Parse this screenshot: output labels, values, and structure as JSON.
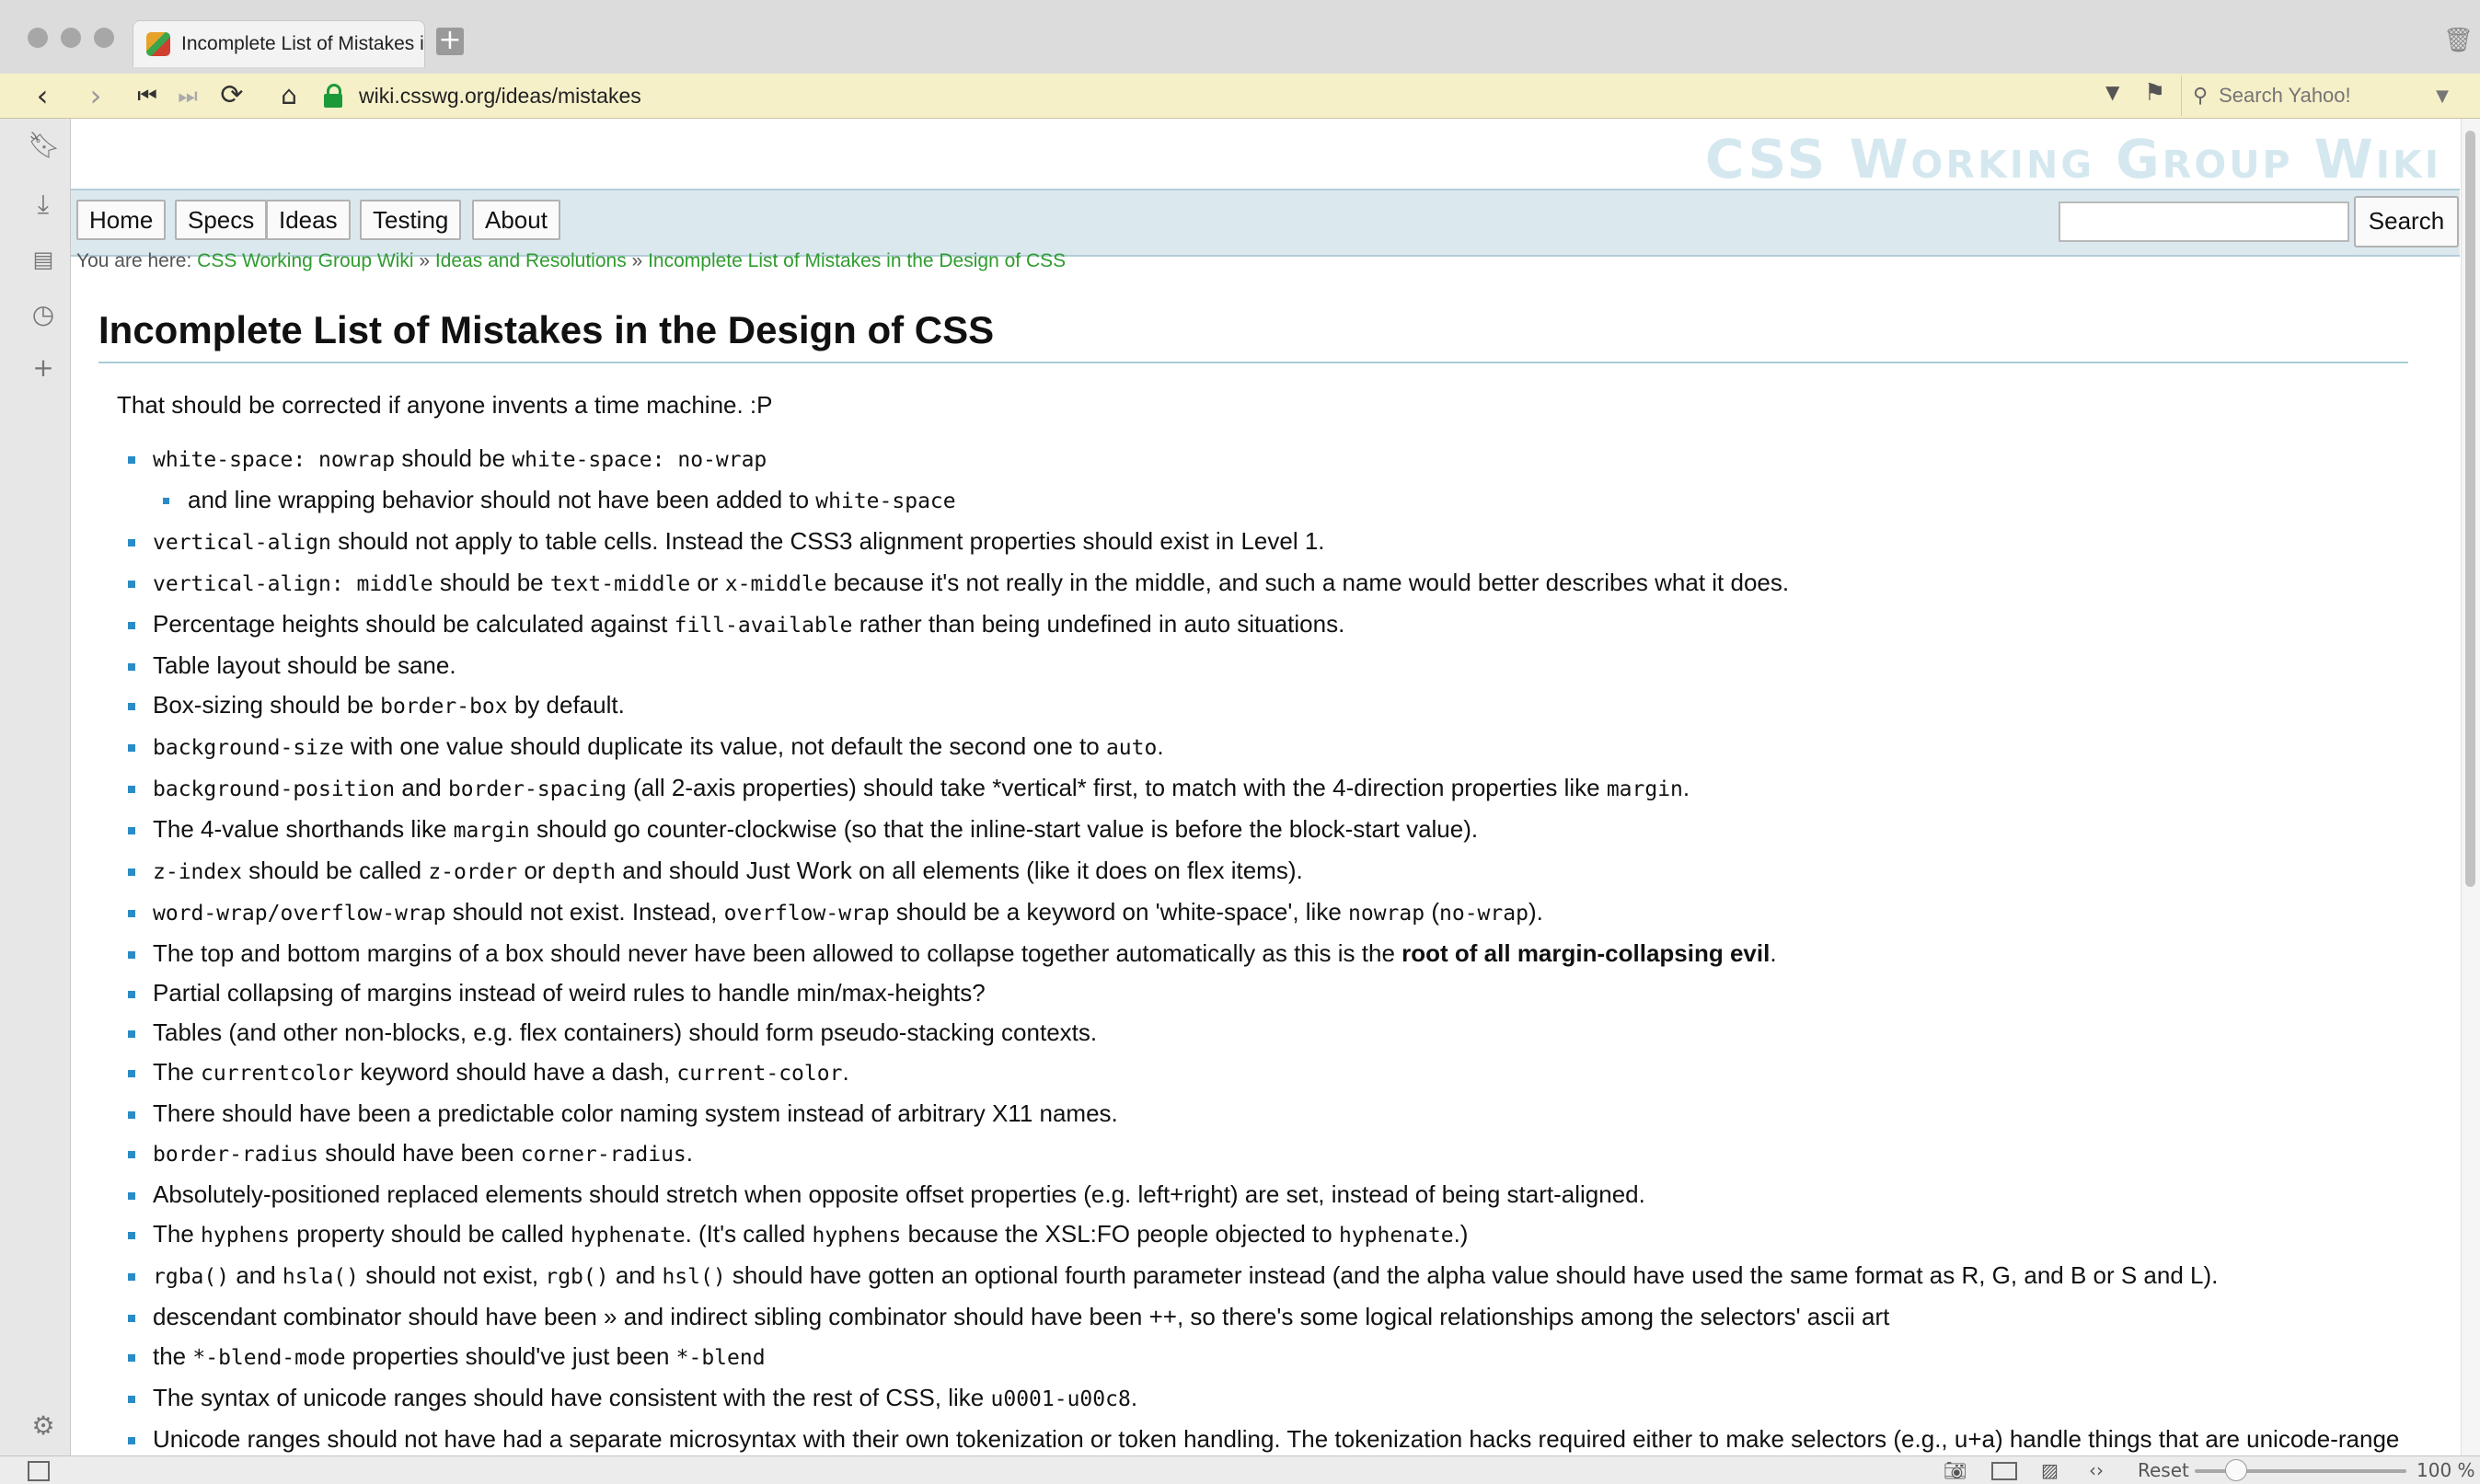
{
  "browser": {
    "tab_title": "Incomplete List of Mistakes in",
    "new_tab": "+",
    "url": "wiki.csswg.org/ideas/mistakes",
    "search_placeholder": "Search Yahoo!",
    "status": {
      "reset_label": "Reset",
      "zoom_label": "100 %",
      "zoom_value": 1.0
    },
    "icons": {
      "back": "arrow-left-icon",
      "forward": "arrow-right-icon",
      "first": "rewind-icon",
      "last": "fast-forward-icon",
      "reload": "reload-icon",
      "home": "home-icon",
      "lock": "lock-icon",
      "bookmarks": "bookmark-icon",
      "downloads": "download-icon",
      "notes": "notes-icon",
      "history": "clock-icon",
      "add_panel": "plus-icon",
      "settings": "gear-icon"
    }
  },
  "site": {
    "wiki_title": "CSS Working Group Wiki",
    "nav": [
      "Home",
      "Specs",
      "Ideas",
      "Testing",
      "About"
    ],
    "search_button": "Search",
    "breadcrumb": {
      "prefix": "You are here:",
      "items": [
        "CSS Working Group Wiki",
        "Ideas and Resolutions",
        "Incomplete List of Mistakes in the Design of CSS"
      ],
      "separator": "»"
    }
  },
  "article": {
    "title": "Incomplete List of Mistakes in the Design of CSS",
    "intro": "That should be corrected if anyone invents a time machine. :P",
    "items": [
      {
        "sub": false,
        "parts": [
          {
            "code": "white-space: nowrap"
          },
          {
            "text": " should be "
          },
          {
            "code": "white-space: no-wrap"
          }
        ]
      },
      {
        "sub": true,
        "parts": [
          {
            "text": "and line wrapping behavior should not have been added to "
          },
          {
            "code": "white-space"
          }
        ]
      },
      {
        "sub": false,
        "parts": [
          {
            "code": "vertical-align"
          },
          {
            "text": " should not apply to table cells. Instead the CSS3 alignment properties should exist in Level 1."
          }
        ]
      },
      {
        "sub": false,
        "parts": [
          {
            "code": "vertical-align: middle"
          },
          {
            "text": " should be "
          },
          {
            "code": "text-middle"
          },
          {
            "text": " or "
          },
          {
            "code": "x-middle"
          },
          {
            "text": " because it's not really in the middle, and such a name would better describes what it does."
          }
        ]
      },
      {
        "sub": false,
        "parts": [
          {
            "text": "Percentage heights should be calculated against "
          },
          {
            "code": "fill-available"
          },
          {
            "text": " rather than being undefined in auto situations."
          }
        ]
      },
      {
        "sub": false,
        "parts": [
          {
            "text": "Table layout should be sane."
          }
        ]
      },
      {
        "sub": false,
        "parts": [
          {
            "text": "Box-sizing should be "
          },
          {
            "code": "border-box"
          },
          {
            "text": " by default."
          }
        ]
      },
      {
        "sub": false,
        "parts": [
          {
            "code": "background-size"
          },
          {
            "text": " with one value should duplicate its value, not default the second one to "
          },
          {
            "code": "auto"
          },
          {
            "text": "."
          }
        ]
      },
      {
        "sub": false,
        "parts": [
          {
            "code": "background-position"
          },
          {
            "text": " and "
          },
          {
            "code": "border-spacing"
          },
          {
            "text": " (all 2-axis properties) should take *vertical* first, to match with the 4-direction properties like "
          },
          {
            "code": "margin"
          },
          {
            "text": "."
          }
        ]
      },
      {
        "sub": false,
        "parts": [
          {
            "text": "The 4-value shorthands like "
          },
          {
            "code": "margin"
          },
          {
            "text": " should go counter-clockwise (so that the inline-start value is before the block-start value)."
          }
        ]
      },
      {
        "sub": false,
        "parts": [
          {
            "code": "z-index"
          },
          {
            "text": " should be called "
          },
          {
            "code": "z-order"
          },
          {
            "text": " or "
          },
          {
            "code": "depth"
          },
          {
            "text": " and should Just Work on all elements (like it does on flex items)."
          }
        ]
      },
      {
        "sub": false,
        "parts": [
          {
            "code": "word-wrap/overflow-wrap"
          },
          {
            "text": " should not exist. Instead, "
          },
          {
            "code": "overflow-wrap"
          },
          {
            "text": " should be a keyword on 'white-space', like "
          },
          {
            "code": "nowrap"
          },
          {
            "text": " ("
          },
          {
            "code": "no-wrap"
          },
          {
            "text": ")."
          }
        ]
      },
      {
        "sub": false,
        "parts": [
          {
            "text": "The top and bottom margins of a box should never have been allowed to collapse together automatically as this is the "
          },
          {
            "bold": "root of all margin-collapsing evil"
          },
          {
            "text": "."
          }
        ]
      },
      {
        "sub": false,
        "parts": [
          {
            "text": "Partial collapsing of margins instead of weird rules to handle min/max-heights?"
          }
        ]
      },
      {
        "sub": false,
        "parts": [
          {
            "text": "Tables (and other non-blocks, e.g. flex containers) should form pseudo-stacking contexts."
          }
        ]
      },
      {
        "sub": false,
        "parts": [
          {
            "text": "The "
          },
          {
            "code": "currentcolor"
          },
          {
            "text": " keyword should have a dash, "
          },
          {
            "code": "current-color"
          },
          {
            "text": "."
          }
        ]
      },
      {
        "sub": false,
        "parts": [
          {
            "text": "There should have been a predictable color naming system instead of arbitrary X11 names."
          }
        ]
      },
      {
        "sub": false,
        "parts": [
          {
            "code": "border-radius"
          },
          {
            "text": " should have been "
          },
          {
            "code": "corner-radius"
          },
          {
            "text": "."
          }
        ]
      },
      {
        "sub": false,
        "parts": [
          {
            "text": "Absolutely-positioned replaced elements should stretch when opposite offset properties (e.g. left+right) are set, instead of being start-aligned."
          }
        ]
      },
      {
        "sub": false,
        "parts": [
          {
            "text": "The "
          },
          {
            "code": "hyphens"
          },
          {
            "text": " property should be called "
          },
          {
            "code": "hyphenate"
          },
          {
            "text": ". (It's called "
          },
          {
            "code": "hyphens"
          },
          {
            "text": " because the XSL:FO people objected to "
          },
          {
            "code": "hyphenate"
          },
          {
            "text": ".)"
          }
        ]
      },
      {
        "sub": false,
        "parts": [
          {
            "code": "rgba()"
          },
          {
            "text": " and "
          },
          {
            "code": "hsla()"
          },
          {
            "text": " should not exist, "
          },
          {
            "code": "rgb()"
          },
          {
            "text": " and "
          },
          {
            "code": "hsl()"
          },
          {
            "text": " should have gotten an optional fourth parameter instead (and the alpha value should have used the same format as R, G, and B or S and L)."
          }
        ]
      },
      {
        "sub": false,
        "parts": [
          {
            "text": "descendant combinator should have been » and indirect sibling combinator should have been ++, so there's some logical relationships among the selectors' ascii art"
          }
        ]
      },
      {
        "sub": false,
        "parts": [
          {
            "text": "the "
          },
          {
            "code": "*-blend-mode"
          },
          {
            "text": " properties should've just been "
          },
          {
            "code": "*-blend"
          }
        ]
      },
      {
        "sub": false,
        "parts": [
          {
            "text": "The syntax of unicode ranges should have consistent with the rest of CSS, like "
          },
          {
            "code": "u0001-u00c8"
          },
          {
            "text": "."
          }
        ]
      },
      {
        "sub": false,
        "parts": [
          {
            "text": "Unicode ranges should not have had a separate microsyntax with their own tokenization or token handling. The tokenization hacks required either to make selectors (e.g., u+a) handle things that are unicode-range tokens, or make unicode-range handle the other huge range of tokens (numbers and dimensions with and without scientific notation, identifiers, +) are both horrible."
          }
        ]
      }
    ]
  },
  "colors": {
    "toolbar_bg": "#f6f0c9",
    "nav_strip_bg": "#dbe9ef",
    "link_green": "#2f9c2f",
    "bullet_blue": "#2a8cc6",
    "wiki_title_color": "#d5e8ef"
  }
}
